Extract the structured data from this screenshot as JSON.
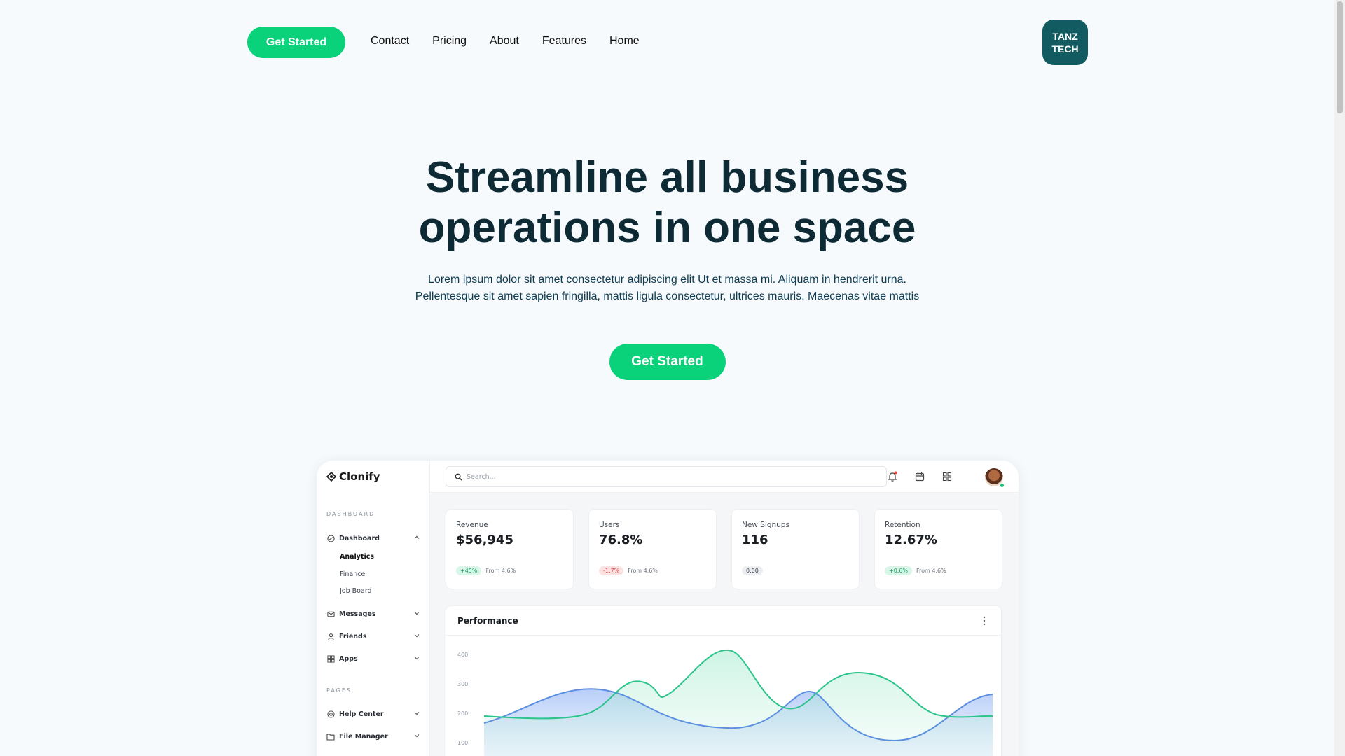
{
  "nav": {
    "cta_label": "Get Started",
    "links": [
      "Contact",
      "Pricing",
      "About",
      "Features",
      "Home"
    ],
    "brand": "TANZ\nTECH"
  },
  "hero": {
    "title": "Streamline all business operations in one space",
    "subtitle": "Lorem ipsum dolor sit amet consectetur adipiscing elit Ut et massa mi. Aliquam in hendrerit urna. Pellentesque sit amet sapien fringilla, mattis ligula consectetur, ultrices mauris. Maecenas vitae mattis",
    "cta_label": "Get Started"
  },
  "colors": {
    "accent": "#09d27a",
    "brand": "#125b60",
    "heading": "#0e2a35"
  },
  "dashboard": {
    "logo_text": "Clonify",
    "search_placeholder": "Search...",
    "sidebar": {
      "section_dashboard": "DASHBOARD",
      "section_pages": "PAGES",
      "items": [
        {
          "label": "Dashboard",
          "icon": "dashboard-icon"
        },
        {
          "label": "Messages",
          "icon": "mail-icon"
        },
        {
          "label": "Friends",
          "icon": "user-icon"
        },
        {
          "label": "Apps",
          "icon": "apps-icon"
        },
        {
          "label": "Help Center",
          "icon": "help-icon"
        },
        {
          "label": "File Manager",
          "icon": "folder-icon"
        }
      ],
      "subitems": [
        "Analytics",
        "Finance",
        "Job Board"
      ]
    },
    "cards": [
      {
        "label": "Revenue",
        "value": "$56,945",
        "badge": "+45%",
        "badge_type": "green",
        "note": "From 4.6%"
      },
      {
        "label": "Users",
        "value": "76.8%",
        "badge": "-1.7%",
        "badge_type": "red",
        "note": "From 4.6%"
      },
      {
        "label": "New Signups",
        "value": "116",
        "badge": "0.00",
        "badge_type": "gray",
        "note": ""
      },
      {
        "label": "Retention",
        "value": "12.67%",
        "badge": "+0.6%",
        "badge_type": "green",
        "note": "From 4.6%"
      }
    ],
    "performance": {
      "title": "Performance",
      "y_ticks": [
        "400",
        "300",
        "200",
        "100"
      ],
      "series_colors": [
        "#2bc48a",
        "#5b8fe0"
      ]
    }
  }
}
